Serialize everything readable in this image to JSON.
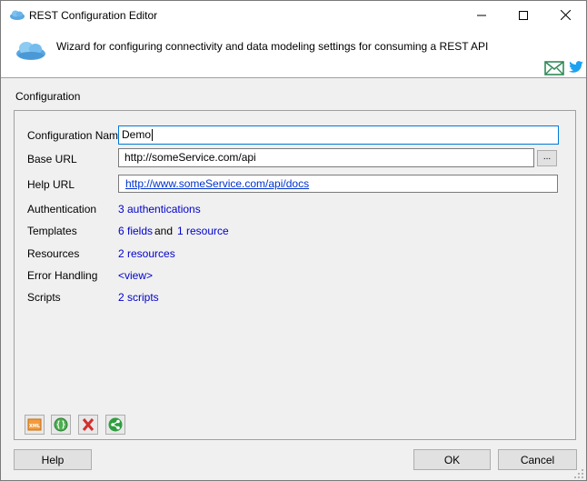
{
  "window": {
    "title": "REST Configuration Editor"
  },
  "banner": {
    "description": "Wizard for configuring connectivity and data modeling settings for consuming a REST API"
  },
  "section": {
    "label": "Configuration"
  },
  "form": {
    "config_name_label": "Configuration Name",
    "config_name_value": "Demo",
    "base_url_label": "Base URL",
    "base_url_value": "http://someService.com/api",
    "browse_label": "...",
    "help_url_label": "Help URL",
    "help_url_value": "http://www.someService.com/api/docs",
    "authentication_label": "Authentication",
    "authentication_link": "3 authentications",
    "templates_label": "Templates",
    "templates_fields_link": "6 fields",
    "templates_and": "and",
    "templates_resource_link": "1 resource",
    "resources_label": "Resources",
    "resources_link": "2 resources",
    "error_handling_label": "Error Handling",
    "error_handling_link": "<view>",
    "scripts_label": "Scripts",
    "scripts_link": "2 scripts"
  },
  "toolbar": {
    "xml_label": "XML",
    "icons": [
      "xml-icon",
      "braces-icon",
      "delete-icon",
      "share-icon"
    ]
  },
  "footer": {
    "help_label": "Help",
    "ok_label": "OK",
    "cancel_label": "Cancel"
  },
  "colors": {
    "link": "#0000cc",
    "focus_border": "#0078d7",
    "cloud": "#5ba7e0",
    "mail": "#2e8b57",
    "twitter": "#1da1f2"
  }
}
